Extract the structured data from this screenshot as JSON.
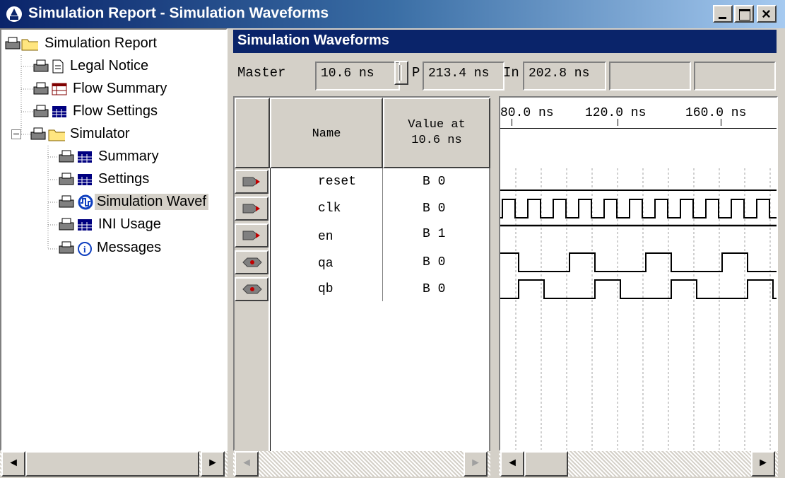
{
  "window": {
    "title": "Simulation Report - Simulation Waveforms",
    "buttons": [
      "_",
      "□",
      "×"
    ]
  },
  "tree": {
    "items": [
      {
        "label": "Simulation Report",
        "icon": "folder-icon"
      },
      {
        "label": "Legal Notice",
        "icon": "document-icon"
      },
      {
        "label": "Flow Summary",
        "icon": "table-icon"
      },
      {
        "label": "Flow Settings",
        "icon": "table-icon"
      },
      {
        "label": "Simulator",
        "icon": "folder-icon",
        "expander": "−"
      },
      {
        "label": "Summary",
        "icon": "table-icon"
      },
      {
        "label": "Settings",
        "icon": "table-icon"
      },
      {
        "label": "Simulation Wavef",
        "icon": "waveform-icon",
        "selected": true
      },
      {
        "label": "INI Usage",
        "icon": "table-icon"
      },
      {
        "label": "Messages",
        "icon": "info-icon"
      }
    ]
  },
  "panel": {
    "title": "Simulation Waveforms",
    "master_label": "Master",
    "master_value": "10.6 ns",
    "pointer_label": "P",
    "pointer_value": "213.4 ns",
    "interval_label": "In",
    "interval_value": "202.8 ns"
  },
  "grid": {
    "name_header": "Name",
    "value_header_line1": "Value at",
    "value_header_line2": "10.6 ns",
    "signals": [
      {
        "name": "reset",
        "value": "B 0",
        "type": "input"
      },
      {
        "name": "clk",
        "value": "B 0",
        "type": "input"
      },
      {
        "name": "en",
        "value": "B 1",
        "type": "input"
      },
      {
        "name": "qa",
        "value": "B 0",
        "type": "output"
      },
      {
        "name": "qb",
        "value": "B 0",
        "type": "output"
      }
    ]
  },
  "timeline": {
    "ticks": [
      "80.0 ns",
      "120.0 ns",
      "160.0 ns"
    ]
  },
  "scroll": {
    "left": "◄",
    "right": "►"
  }
}
